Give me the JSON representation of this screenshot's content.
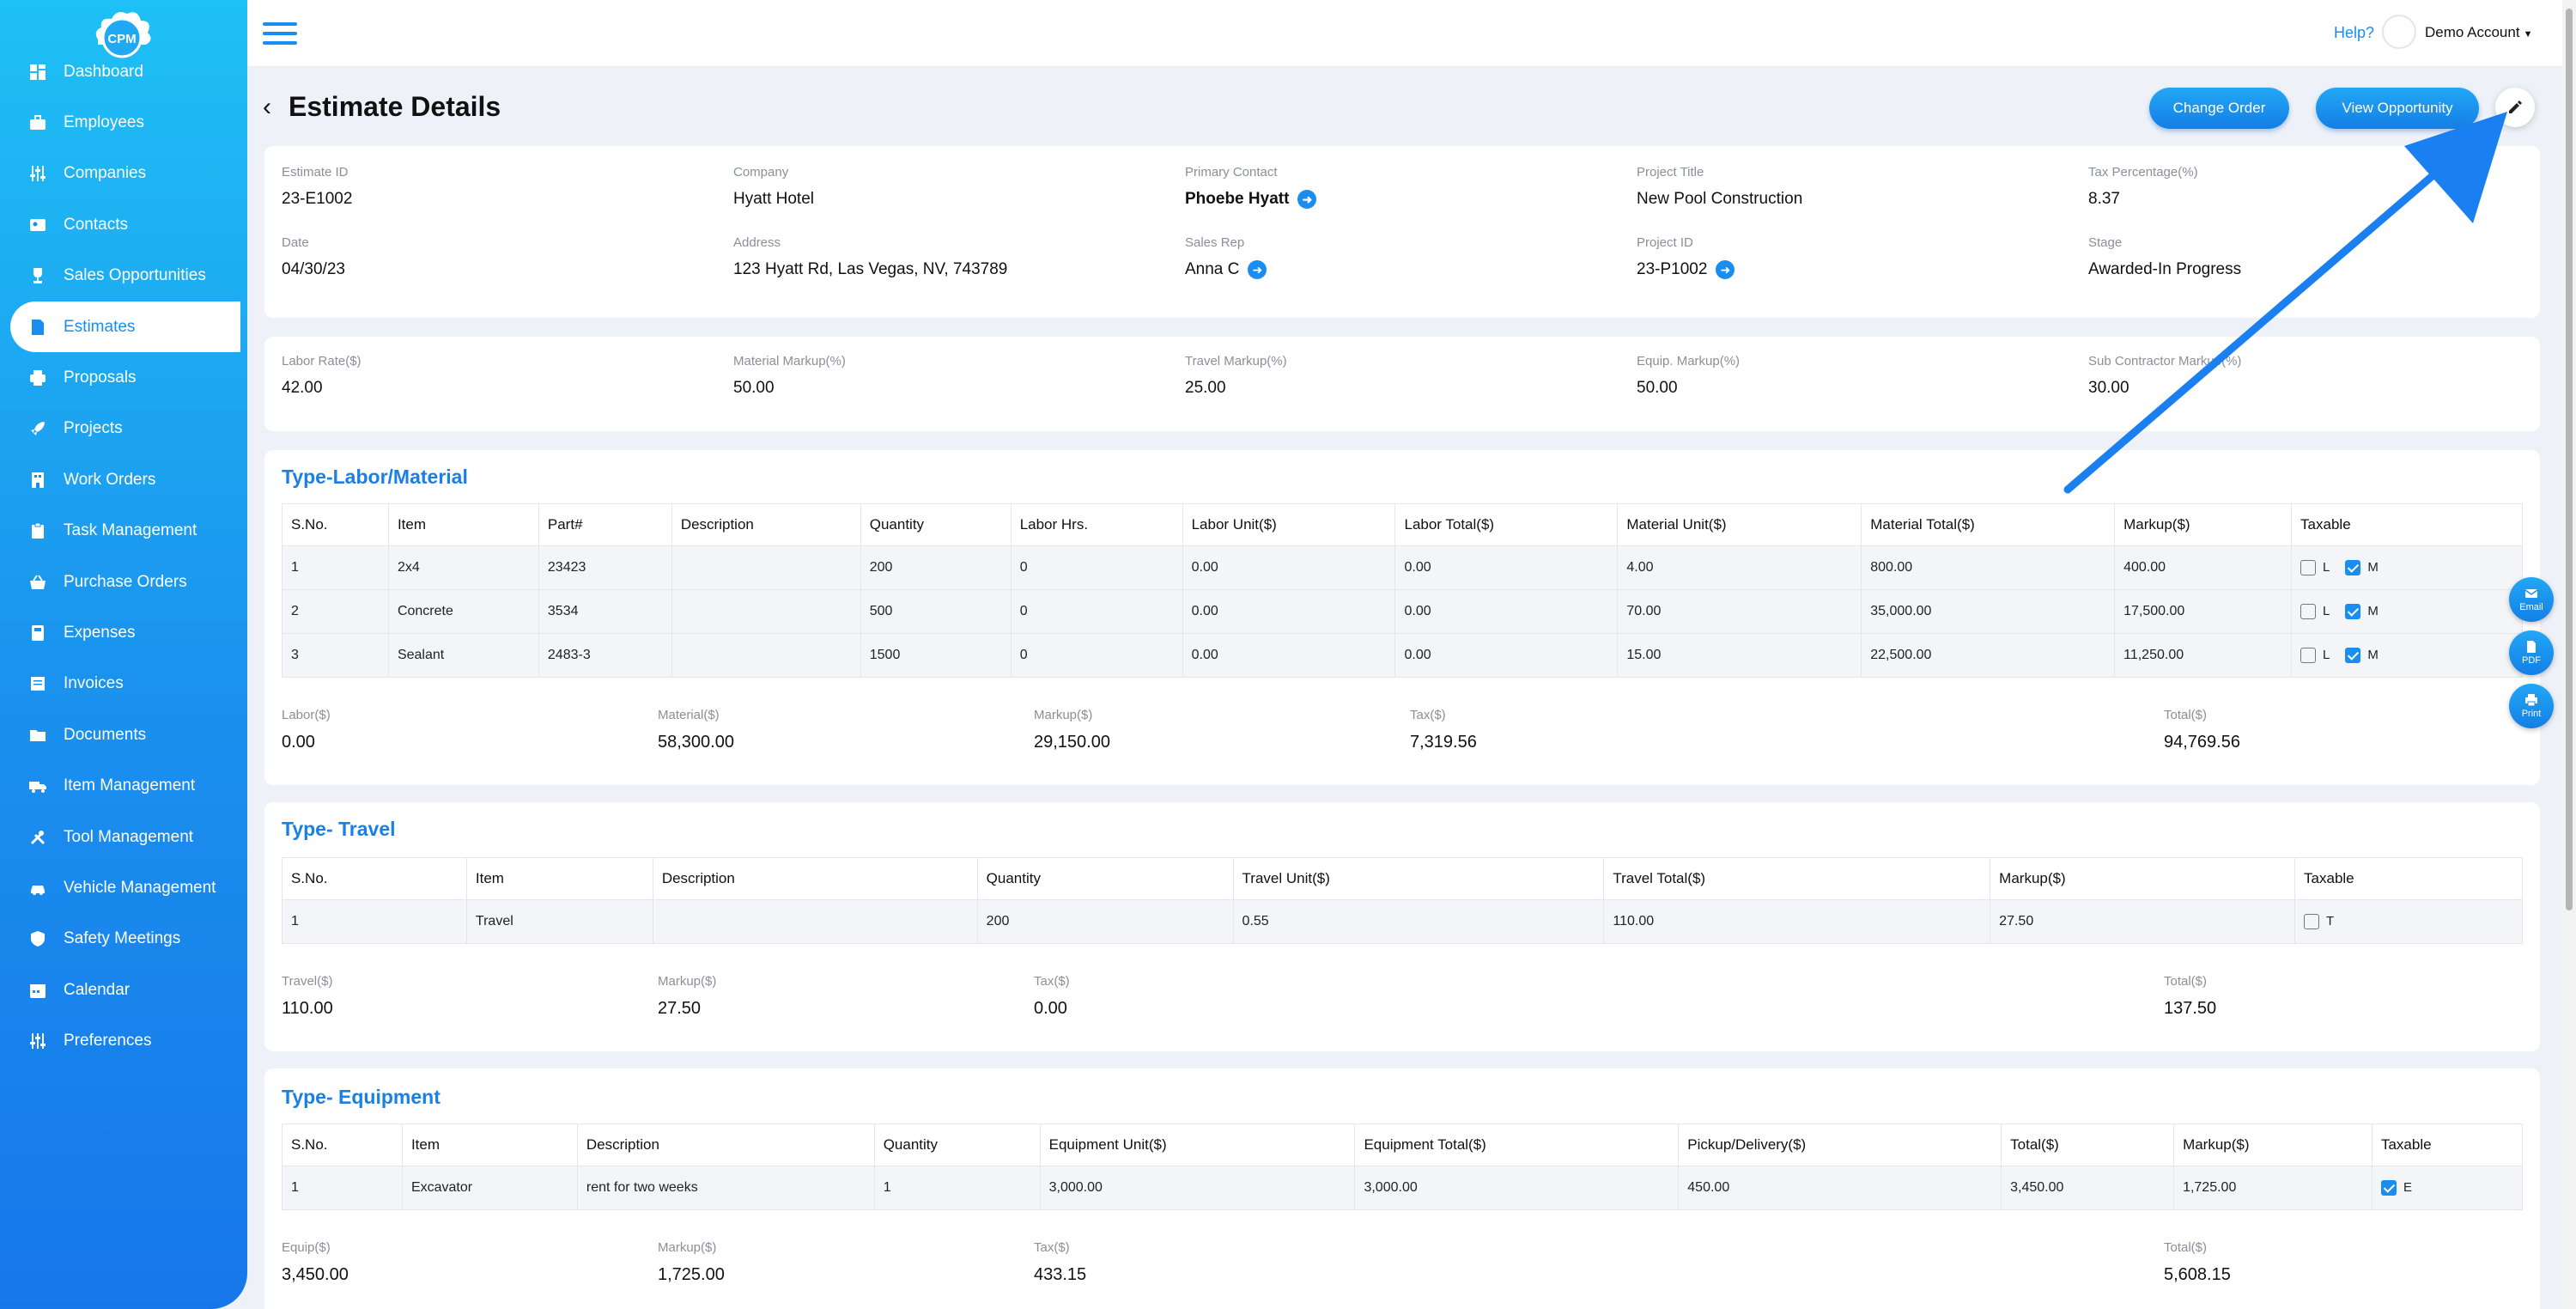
{
  "app": {
    "logo_text": "CPM"
  },
  "sidebar": {
    "items": [
      {
        "label": "Dashboard",
        "icon": "dashboard-icon"
      },
      {
        "label": "Employees",
        "icon": "briefcase-icon"
      },
      {
        "label": "Companies",
        "icon": "sliders-icon"
      },
      {
        "label": "Contacts",
        "icon": "contact-card-icon"
      },
      {
        "label": "Sales Opportunities",
        "icon": "trophy-icon"
      },
      {
        "label": "Estimates",
        "icon": "document-icon",
        "active": true
      },
      {
        "label": "Proposals",
        "icon": "printer-icon"
      },
      {
        "label": "Projects",
        "icon": "rocket-icon"
      },
      {
        "label": "Work Orders",
        "icon": "building-icon"
      },
      {
        "label": "Task Management",
        "icon": "clipboard-icon"
      },
      {
        "label": "Purchase Orders",
        "icon": "basket-icon"
      },
      {
        "label": "Expenses",
        "icon": "calculator-icon"
      },
      {
        "label": "Invoices",
        "icon": "invoice-icon"
      },
      {
        "label": "Documents",
        "icon": "folder-icon"
      },
      {
        "label": "Item Management",
        "icon": "truck-icon"
      },
      {
        "label": "Tool Management",
        "icon": "tools-icon"
      },
      {
        "label": "Vehicle Management",
        "icon": "car-icon"
      },
      {
        "label": "Safety Meetings",
        "icon": "shield-icon"
      },
      {
        "label": "Calendar",
        "icon": "calendar-icon"
      },
      {
        "label": "Preferences",
        "icon": "sliders-icon"
      }
    ]
  },
  "topbar": {
    "help": "Help?",
    "account": "Demo Account"
  },
  "page": {
    "title": "Estimate Details",
    "change_order": "Change Order",
    "view_opportunity": "View Opportunity"
  },
  "details": {
    "estimate_id": {
      "label": "Estimate ID",
      "value": "23-E1002"
    },
    "company": {
      "label": "Company",
      "value": "Hyatt Hotel"
    },
    "primary_contact": {
      "label": "Primary Contact",
      "value": "Phoebe Hyatt"
    },
    "project_title": {
      "label": "Project Title",
      "value": "New Pool Construction"
    },
    "tax_percentage": {
      "label": "Tax Percentage(%)",
      "value": "8.37"
    },
    "date": {
      "label": "Date",
      "value": "04/30/23"
    },
    "address": {
      "label": "Address",
      "value": "123 Hyatt Rd, Las Vegas, NV, 743789"
    },
    "sales_rep": {
      "label": "Sales Rep",
      "value": "Anna C"
    },
    "project_id": {
      "label": "Project ID",
      "value": "23-P1002"
    },
    "stage": {
      "label": "Stage",
      "value": "Awarded-In Progress"
    }
  },
  "rates": {
    "labor_rate": {
      "label": "Labor Rate($)",
      "value": "42.00"
    },
    "material_markup": {
      "label": "Material Markup(%)",
      "value": "50.00"
    },
    "travel_markup": {
      "label": "Travel Markup(%)",
      "value": "25.00"
    },
    "equip_markup": {
      "label": "Equip. Markup(%)",
      "value": "50.00"
    },
    "sub_markup": {
      "label": "Sub Contractor Markup(%)",
      "value": "30.00"
    }
  },
  "labor": {
    "title": "Type-Labor/Material",
    "columns": [
      "S.No.",
      "Item",
      "Part#",
      "Description",
      "Quantity",
      "Labor Hrs.",
      "Labor Unit($)",
      "Labor Total($)",
      "Material Unit($)",
      "Material Total($)",
      "Markup($)",
      "Taxable"
    ],
    "rows": [
      [
        "1",
        "2x4",
        "23423",
        "",
        "200",
        "0",
        "0.00",
        "0.00",
        "4.00",
        "800.00",
        "400.00"
      ],
      [
        "2",
        "Concrete",
        "3534",
        "",
        "500",
        "0",
        "0.00",
        "0.00",
        "70.00",
        "35,000.00",
        "17,500.00"
      ],
      [
        "3",
        "Sealant",
        "2483-3",
        "",
        "1500",
        "0",
        "0.00",
        "0.00",
        "15.00",
        "22,500.00",
        "11,250.00"
      ]
    ],
    "tax_l": "L",
    "tax_m": "M",
    "summary": {
      "labor": {
        "label": "Labor($)",
        "value": "0.00"
      },
      "material": {
        "label": "Material($)",
        "value": "58,300.00"
      },
      "markup": {
        "label": "Markup($)",
        "value": "29,150.00"
      },
      "tax": {
        "label": "Tax($)",
        "value": "7,319.56"
      },
      "total": {
        "label": "Total($)",
        "value": "94,769.56"
      }
    }
  },
  "travel": {
    "title": "Type- Travel",
    "columns": [
      "S.No.",
      "Item",
      "Description",
      "Quantity",
      "Travel Unit($)",
      "Travel Total($)",
      "Markup($)",
      "Taxable"
    ],
    "rows": [
      [
        "1",
        "Travel",
        "",
        "200",
        "0.55",
        "110.00",
        "27.50"
      ]
    ],
    "tax_t": "T",
    "summary": {
      "travel": {
        "label": "Travel($)",
        "value": "110.00"
      },
      "markup": {
        "label": "Markup($)",
        "value": "27.50"
      },
      "tax": {
        "label": "Tax($)",
        "value": "0.00"
      },
      "total": {
        "label": "Total($)",
        "value": "137.50"
      }
    }
  },
  "equipment": {
    "title": "Type- Equipment",
    "columns": [
      "S.No.",
      "Item",
      "Description",
      "Quantity",
      "Equipment Unit($)",
      "Equipment Total($)",
      "Pickup/Delivery($)",
      "Total($)",
      "Markup($)",
      "Taxable"
    ],
    "rows": [
      [
        "1",
        "Excavator",
        "rent for two weeks",
        "1",
        "3,000.00",
        "3,000.00",
        "450.00",
        "3,450.00",
        "1,725.00"
      ]
    ],
    "tax_e": "E",
    "summary": {
      "equip": {
        "label": "Equip($)",
        "value": "3,450.00"
      },
      "markup": {
        "label": "Markup($)",
        "value": "1,725.00"
      },
      "tax": {
        "label": "Tax($)",
        "value": "433.15"
      },
      "total": {
        "label": "Total($)",
        "value": "5,608.15"
      }
    }
  },
  "side_actions": {
    "email": "Email",
    "pdf": "PDF",
    "print": "Print"
  },
  "colors": {
    "accent": "#1a8ef0",
    "sidebar_top": "#1fc0f5",
    "sidebar_bottom": "#1777ea",
    "section_title": "#1a7fe6"
  }
}
